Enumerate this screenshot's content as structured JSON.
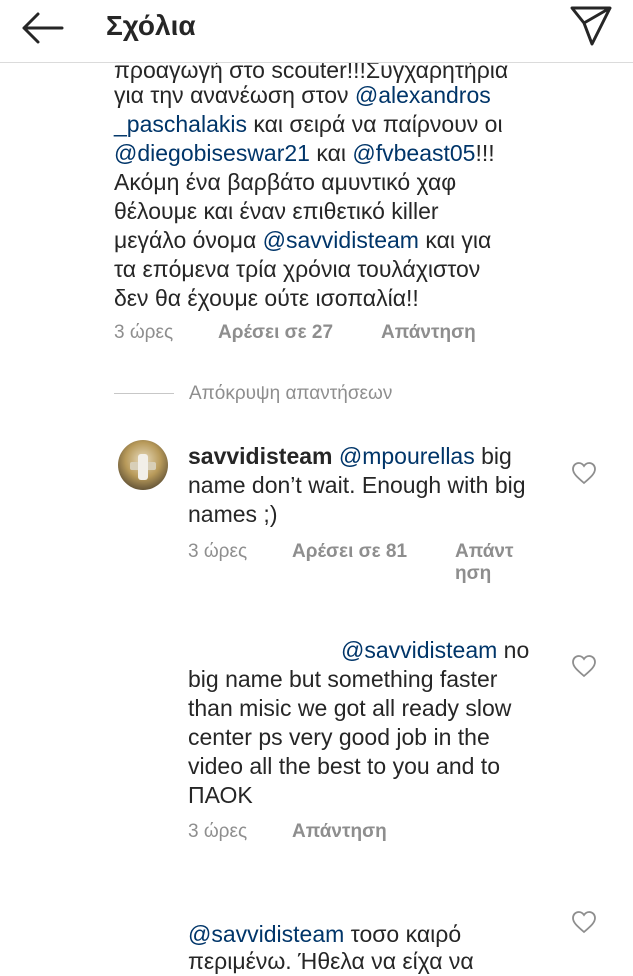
{
  "header": {
    "title": "Σχόλια"
  },
  "comment1": {
    "cut_line": "προαγωγή στο scouter!!!Συγχαρητήρια",
    "lines": [
      {
        "text": "για την ανανέωση στον ",
        "mention": "@alexandros"
      },
      {
        "mention": "_paschalakis",
        "text": "  και σειρά να παίρνουν οι"
      },
      {
        "mention": "@diegobiseswar21",
        "text": "  και  ",
        "mention2": "@fvbeast05",
        "text2": "!!!"
      },
      {
        "text": "Ακόμη ένα βαρβάτο αμυντικό χαφ"
      },
      {
        "text": "θέλουμε και έναν επιθετικό killer"
      },
      {
        "text": "μεγάλο όνομα ",
        "mention": "@savvidisteam",
        "text2": " και για"
      },
      {
        "text": "τα επόμενα τρία χρόνια τουλάχιστον"
      },
      {
        "text": "δεν θα έχουμε ούτε ισοπαλία!!"
      }
    ],
    "time": "3 ώρες",
    "likes": "Αρέσει σε 27",
    "reply": "Απάντηση"
  },
  "hide_replies": "Απόκρυψη απαντήσεων",
  "reply1": {
    "username": "savvidisteam",
    "mention": "@mpourellas",
    "lines": [
      "big",
      "name don’t wait. Enough with big",
      "names ;)"
    ],
    "time": "3 ώρες",
    "likes": "Αρέσει σε 81",
    "reply_line1": "Απάντ",
    "reply_line2": "ηση"
  },
  "reply2": {
    "mention": "@savvidisteam",
    "first_tail": " no",
    "lines": [
      "big name but something faster",
      "than misic  we got all ready slow",
      "center  ps very good job in the",
      "video  all the best to you and to",
      "ΠΑΟΚ"
    ],
    "time": "3 ώρες",
    "reply": "Απάντηση"
  },
  "reply3": {
    "mention": "@savvidisteam",
    "tail": " τοσο καιρό",
    "cut_line": "περιμένω. Ήθελα να είχα να"
  }
}
